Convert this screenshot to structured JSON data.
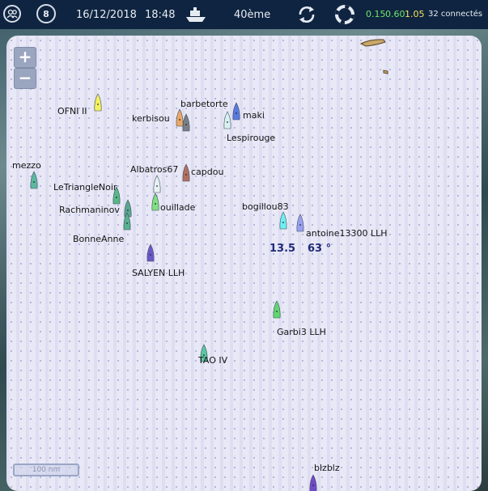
{
  "header": {
    "date": "16/12/2018",
    "time": "18:48",
    "rank": "40ème",
    "count_badge": "8",
    "speeds": {
      "low": "0.15",
      "mid": "0.60",
      "high": "1.05"
    },
    "connected": "32 connectés",
    "icons": [
      "users-icon",
      "compass-icon",
      "boat-icon",
      "refresh-icon",
      "lifebuoy-icon"
    ]
  },
  "map": {
    "zoom_in": "+",
    "zoom_out": "−",
    "scale": "100 nm",
    "wind_speed": "13.5",
    "wind_direction": "63 °",
    "boats": [
      {
        "name": "OFNI II",
        "color": "#f4f060"
      },
      {
        "name": "barbetorte",
        "color": "#7a7f86"
      },
      {
        "name": "kerbisou",
        "color": "#e8a868"
      },
      {
        "name": "maki",
        "color": "#5a7ae0"
      },
      {
        "name": "Lespirouge",
        "color": "#d8f0f0"
      },
      {
        "name": "mezzo",
        "color": "#5ab8a0"
      },
      {
        "name": "Albatros67",
        "color": "#e8f2f2"
      },
      {
        "name": "capdou",
        "color": "#b07060"
      },
      {
        "name": "LeTriangleNoir",
        "color": "#58b888"
      },
      {
        "name": "Rachmaninov",
        "color": "#5aa890"
      },
      {
        "name": "ouillade",
        "color": "#80e080"
      },
      {
        "name": "BonneAnne",
        "color": "#58b090"
      },
      {
        "name": "bogillou83",
        "color": "#70eef0"
      },
      {
        "name": "antoine13300 LLH",
        "color": "#9aa0f0"
      },
      {
        "name": "SALYEN LLH",
        "color": "#6858c8"
      },
      {
        "name": "Garbi3 LLH",
        "color": "#60d870"
      },
      {
        "name": "TAO IV",
        "color": "#58c8a0"
      },
      {
        "name": "blzblz",
        "color": "#7048c8"
      }
    ]
  }
}
